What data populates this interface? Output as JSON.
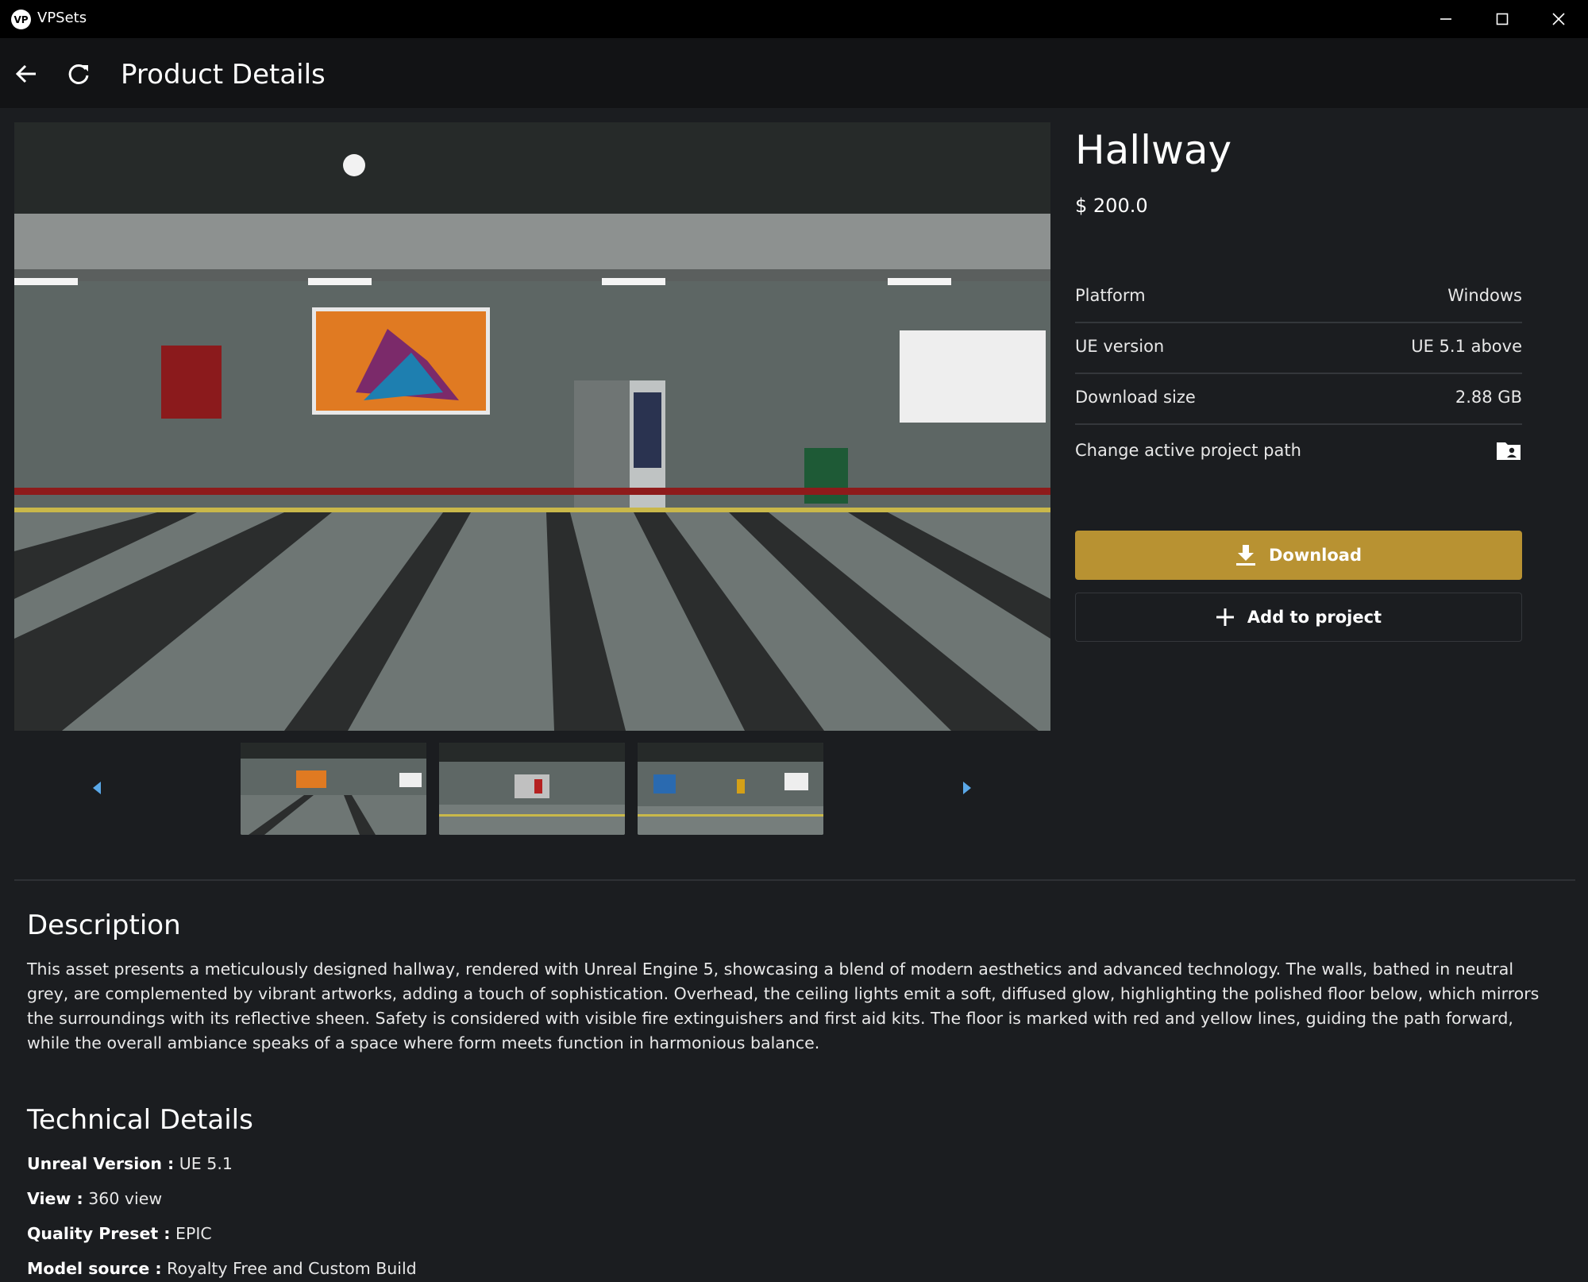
{
  "window": {
    "app_logo_text": "VP",
    "app_title": "VPSets"
  },
  "toolbar": {
    "page_title": "Product Details"
  },
  "product": {
    "name": "Hallway",
    "price": "$ 200.0",
    "specs": [
      {
        "label": "Platform",
        "value": "Windows"
      },
      {
        "label": "UE version",
        "value": "UE 5.1 above"
      },
      {
        "label": "Download size",
        "value": "2.88 GB"
      }
    ],
    "change_path_label": "Change active project path",
    "download_label": "Download",
    "add_to_project_label": "Add to project"
  },
  "description": {
    "heading": "Description",
    "text": "This asset presents a meticulously designed hallway, rendered with Unreal Engine 5, showcasing a blend of modern aesthetics and advanced technology. The walls, bathed in neutral grey, are complemented by vibrant artworks, adding a touch of sophistication. Overhead, the ceiling lights emit a soft, diffused glow, highlighting the polished floor below, which mirrors the surroundings with its reflective sheen. Safety is considered with visible fire extinguishers and first aid kits. The floor is marked with red and yellow lines, guiding the path forward, while the overall ambiance speaks of a space where form meets function in harmonious balance."
  },
  "technical": {
    "heading": "Technical Details",
    "items": [
      {
        "key": "Unreal Version :",
        "value": "UE 5.1"
      },
      {
        "key": "View :",
        "value": "360 view"
      },
      {
        "key": "Quality Preset :",
        "value": "EPIC"
      },
      {
        "key": "Model source :",
        "value": "Royalty Free and Custom Build"
      }
    ]
  },
  "icons": {
    "back": "arrow-left-icon",
    "refresh": "refresh-icon",
    "minimize": "minimize-icon",
    "maximize": "maximize-icon",
    "close": "close-icon",
    "folder": "folder-user-icon",
    "download": "download-icon",
    "add": "plus-icon",
    "prev": "chevron-left-icon",
    "next": "chevron-right-icon"
  },
  "colors": {
    "accent": "#b89232",
    "carousel_arrow": "#5aa8e8",
    "background": "#1b1d20"
  }
}
